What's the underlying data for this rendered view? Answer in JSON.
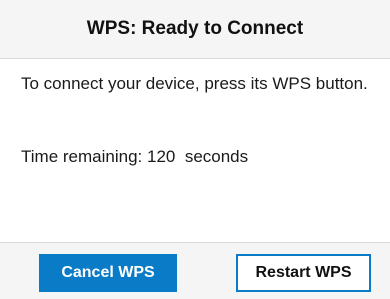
{
  "dialog": {
    "title": "WPS: Ready to Connect",
    "message": "To connect your device, press its WPS button.",
    "timer": {
      "prefix": "Time remaining:",
      "value": "120",
      "unit": "seconds"
    },
    "buttons": {
      "cancel_label": "Cancel WPS",
      "restart_label": "Restart WPS"
    },
    "colors": {
      "accent": "#0a7bc6",
      "header_bg": "#f5f5f5"
    }
  }
}
